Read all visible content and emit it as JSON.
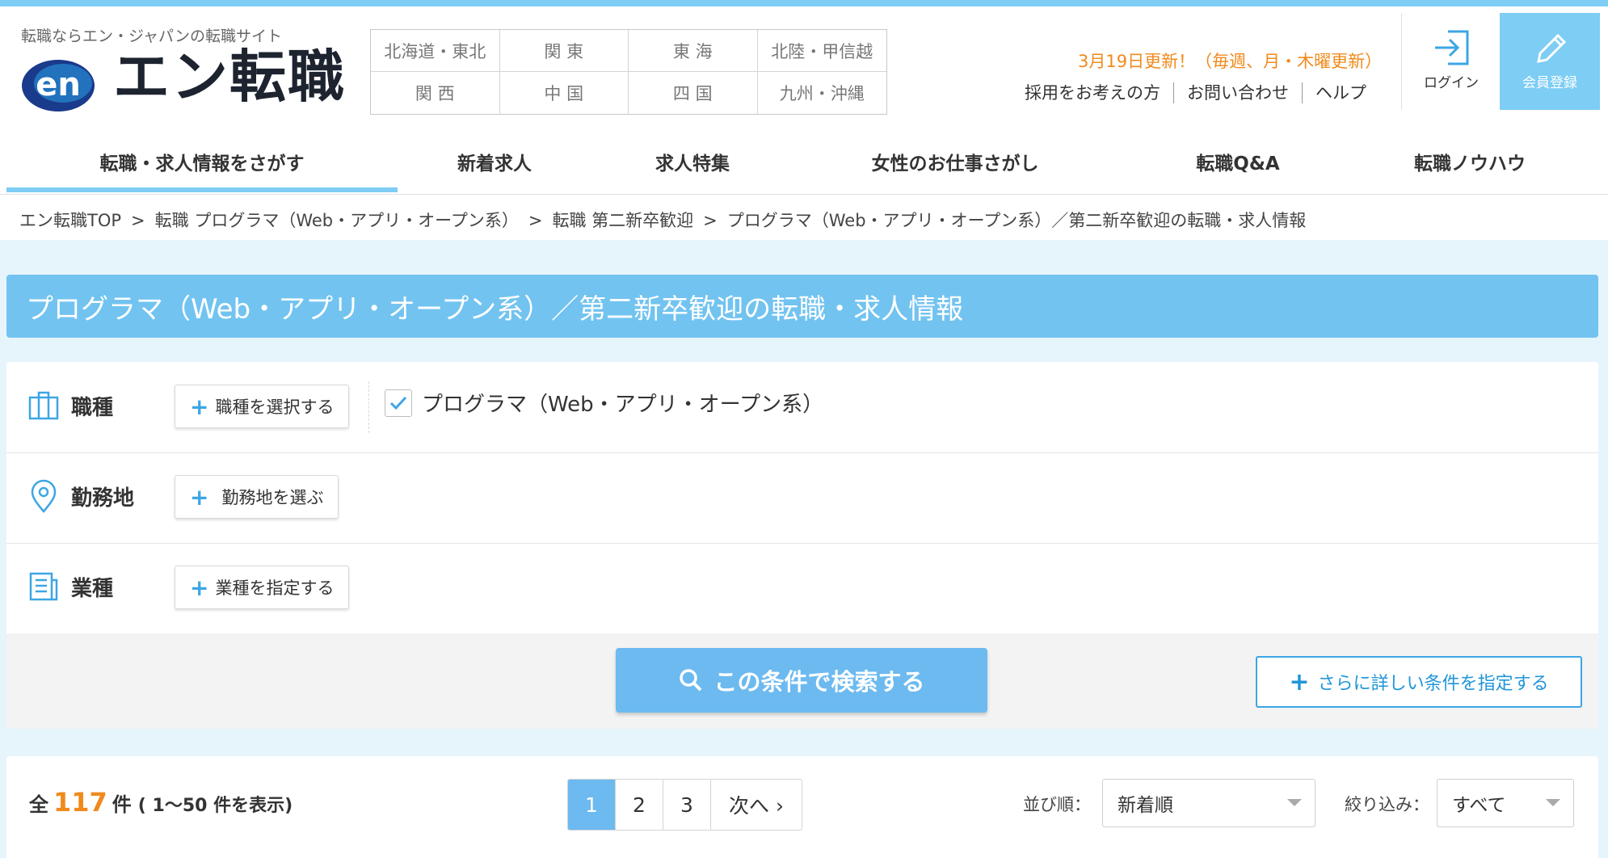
{
  "header": {
    "tagline": "転職ならエン・ジャパンの転職サイト",
    "logo_en": "en",
    "logo_text": "エン転職",
    "regions": [
      "北海道・東北",
      "関 東",
      "東 海",
      "北陸・甲信越",
      "関 西",
      "中 国",
      "四 国",
      "九州・沖縄"
    ],
    "update_notice": "3月19日更新！（毎週、月・木曜更新）",
    "links": [
      "採用をお考えの方",
      "お問い合わせ",
      "ヘルプ"
    ],
    "login_label": "ログイン",
    "register_label": "会員登録"
  },
  "nav": {
    "items": [
      "転職・求人情報をさがす",
      "新着求人",
      "求人特集",
      "女性のお仕事さがし",
      "転職Q&A",
      "転職ノウハウ"
    ]
  },
  "breadcrumb": [
    "エン転職TOP",
    "転職 プログラマ（Web・アプリ・オープン系）",
    "転職 第二新卒歓迎",
    "プログラマ（Web・アプリ・オープン系）／第二新卒歓迎の転職・求人情報"
  ],
  "breadcrumb_sep": ">",
  "page_title": "プログラマ（Web・アプリ・オープン系）／第二新卒歓迎の転職・求人情報",
  "conditions": {
    "job_type": {
      "label": "職種",
      "button": "職種を選択する",
      "selected": "プログラマ（Web・アプリ・オープン系）"
    },
    "location": {
      "label": "勤務地",
      "button": "勤務地を選ぶ"
    },
    "industry": {
      "label": "業種",
      "button": "業種を指定する"
    },
    "search_button": "この条件で検索する",
    "more_button": "さらに詳しい条件を指定する"
  },
  "results": {
    "prefix": "全",
    "total": "117",
    "unit": "件",
    "range": "( 1～50 件を表示)",
    "pages": [
      "1",
      "2",
      "3"
    ],
    "next": "次へ ›",
    "sort_label": "並び順：",
    "sort_value": "新着順",
    "filter_label": "絞り込み：",
    "filter_value": "すべて"
  },
  "colors": {
    "accent": "#7dcdf4",
    "title_bg": "#72c3f0",
    "orange": "#f08a1c",
    "link_blue": "#3ca6e4"
  }
}
